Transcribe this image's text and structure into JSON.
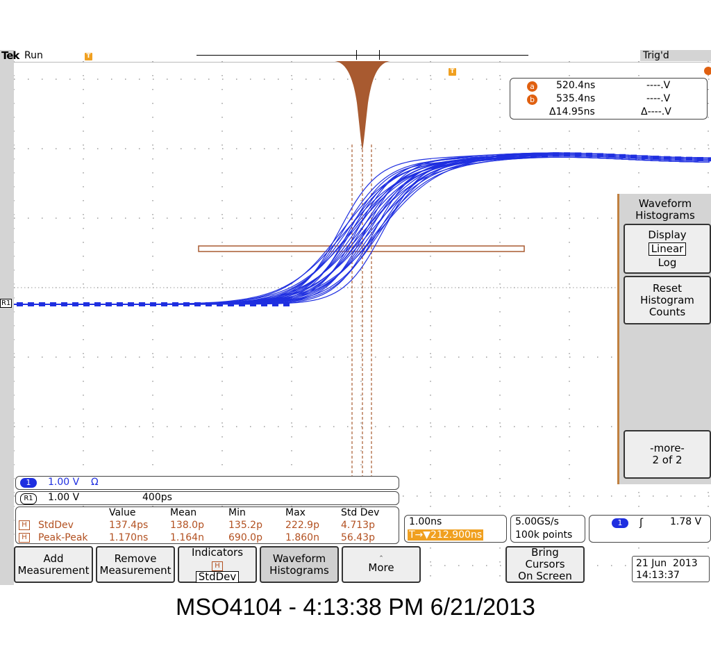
{
  "header": {
    "brand": "Tek",
    "status": "Run",
    "trigger_state": "Trig'd",
    "trigger_marker": "T"
  },
  "cursors": {
    "a_label": "a",
    "b_label": "b",
    "a_time": "520.4ns",
    "a_volt": "----.V",
    "b_time": "535.4ns",
    "b_volt": "----.V",
    "delta_time": "Δ14.95ns",
    "delta_volt": "Δ----.V"
  },
  "ref_marker": "R1",
  "channels": {
    "ch1_badge": "1",
    "ch1_scale": "1.00 V",
    "ch1_ohm": "Ω",
    "r1_badge": "R1",
    "r1_scale": "1.00 V",
    "r1_time": "400ps"
  },
  "measurements": {
    "headers": [
      "Value",
      "Mean",
      "Min",
      "Max",
      "Std Dev"
    ],
    "h_label": "H",
    "rows": [
      {
        "name": "StdDev",
        "value": "137.4ps",
        "mean": "138.0p",
        "min": "135.2p",
        "max": "222.9p",
        "std": "4.713p"
      },
      {
        "name": "Peak-Peak",
        "value": "1.170ns",
        "mean": "1.164n",
        "min": "690.0p",
        "max": "1.860n",
        "std": "56.43p"
      }
    ]
  },
  "timebase": {
    "scale": "1.00ns",
    "position": "T→▼212.900ns"
  },
  "acquisition": {
    "rate": "5.00GS/s",
    "points": "100k points"
  },
  "trigger": {
    "channel": "1",
    "slope": "ʃ",
    "level": "1.78 V"
  },
  "side_menu": {
    "title_line1": "Waveform",
    "title_line2": "Histograms",
    "display_label": "Display",
    "linear_label": "Linear",
    "log_label": "Log",
    "reset_line1": "Reset",
    "reset_line2": "Histogram",
    "reset_line3": "Counts",
    "more_line1": "-more-",
    "more_line2": "2 of 2"
  },
  "bottom_menu": {
    "add_line1": "Add",
    "add_line2": "Measurement",
    "remove_line1": "Remove",
    "remove_line2": "Measurement",
    "ind_line1": "Indicators",
    "ind_h": "H",
    "ind_line2": "StdDev",
    "wh_line1": "Waveform",
    "wh_line2": "Histograms",
    "more_label": "More",
    "bring_line1": "Bring",
    "bring_line2": "Cursors",
    "bring_line3": "On Screen"
  },
  "datetime": {
    "date": "21 Jun  2013",
    "time": "14:13:37"
  },
  "caption": "MSO4104 - 4:13:38 PM   6/21/2013",
  "colors": {
    "waveform": "#1f2fe0",
    "histogram": "#a85a30",
    "accent": "#f0a020",
    "measure": "#b25020"
  }
}
